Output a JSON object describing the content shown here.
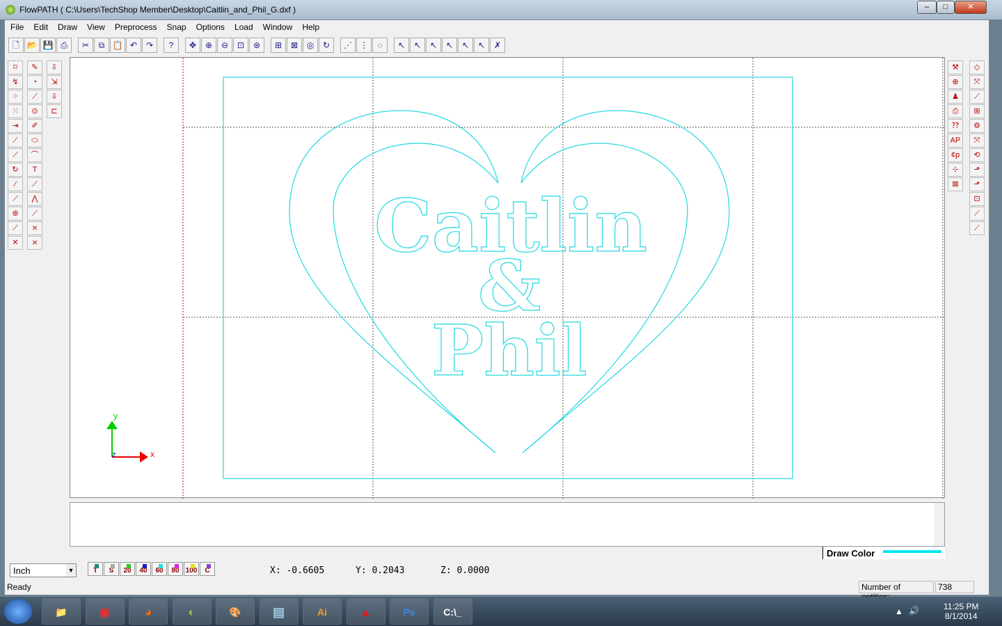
{
  "window": {
    "title": "FlowPATH ( C:\\Users\\TechShop Member\\Desktop\\Caitlin_and_Phil_G.dxf )",
    "minimize": "–",
    "maximize": "□",
    "close": "✕"
  },
  "menu": [
    "File",
    "Edit",
    "Draw",
    "View",
    "Preprocess",
    "Snap",
    "Options",
    "Load",
    "Window",
    "Help"
  ],
  "toolbar": [
    {
      "icon": "new-file-icon",
      "g": "🗋"
    },
    {
      "icon": "open-icon",
      "g": "📂"
    },
    {
      "icon": "save-icon",
      "g": "💾"
    },
    {
      "icon": "print-icon",
      "g": "⎙"
    },
    null,
    {
      "icon": "cut-icon",
      "g": "✂"
    },
    {
      "icon": "copy-icon",
      "g": "⧉"
    },
    {
      "icon": "paste-icon",
      "g": "📋"
    },
    {
      "icon": "undo-icon",
      "g": "↶"
    },
    {
      "icon": "redo-icon",
      "g": "↷"
    },
    null,
    {
      "icon": "help-icon",
      "g": "?"
    },
    null,
    {
      "icon": "pan-icon",
      "g": "✥"
    },
    {
      "icon": "zoom-in-icon",
      "g": "⊕"
    },
    {
      "icon": "zoom-out-icon",
      "g": "⊖"
    },
    {
      "icon": "zoom-window-icon",
      "g": "⊡"
    },
    {
      "icon": "zoom-extents-icon",
      "g": "⊛"
    },
    null,
    {
      "icon": "zoom-fit-icon",
      "g": "⊞"
    },
    {
      "icon": "zoom-all-icon",
      "g": "⊠"
    },
    {
      "icon": "zoom-previous-icon",
      "g": "◎"
    },
    {
      "icon": "redraw-icon",
      "g": "↻"
    },
    null,
    {
      "icon": "snap-points-icon",
      "g": "⋰"
    },
    {
      "icon": "grid-icon",
      "g": "⋮"
    },
    {
      "icon": "snap-arc-icon",
      "g": "◌"
    },
    null,
    {
      "icon": "select-icon",
      "g": "↖"
    },
    {
      "icon": "select-layer-icon",
      "g": "↖"
    },
    {
      "icon": "select-window-icon",
      "g": "↖"
    },
    {
      "icon": "select-chain-icon",
      "g": "↖"
    },
    {
      "icon": "select-line-icon",
      "g": "↖"
    },
    {
      "icon": "select-all-icon",
      "g": "↖"
    },
    {
      "icon": "deselect-icon",
      "g": "✗"
    }
  ],
  "left_tools": [
    [
      "⌑",
      "↯",
      "⁘",
      "⁙",
      "⇥",
      "⟋",
      "⟋",
      "↻",
      "⁄",
      "⟋",
      "⊛",
      "⟋",
      "✕"
    ],
    [
      "✎",
      "◔",
      "⟋",
      "⊙",
      "✐",
      "⬭",
      "⌒",
      "T",
      "⟋",
      "⋀",
      "⟋",
      "⨯",
      "⨯"
    ],
    [
      "⇩",
      "⇲",
      "⇩",
      "⊏"
    ]
  ],
  "right_tools": [
    [
      "⚒",
      "⊕",
      "♟",
      "⎙",
      "⁇",
      "AP",
      "¢p",
      "⊹",
      "⊠"
    ],
    [
      "◇",
      "⤧",
      "⟋",
      "⊞",
      "⚙",
      "⤧",
      "⟲",
      "⬏",
      "⬏",
      "⊡",
      "⟋",
      "⟋"
    ]
  ],
  "drawing": {
    "line1": "Caitlin",
    "line2": "&",
    "line3": "Phil",
    "axis_x": "x",
    "axis_y": "y",
    "axis_z": "z",
    "color": "#22d8e0"
  },
  "draw_color": {
    "label": "Draw Color",
    "color": "#00e5ee"
  },
  "units": "Inch",
  "pens": [
    {
      "label": "T",
      "color": "#1a8a7a"
    },
    {
      "label": "S",
      "color": "#aaaaaa"
    },
    {
      "label": "20",
      "color": "#22cc22"
    },
    {
      "label": "40",
      "color": "#1a1acc"
    },
    {
      "label": "60",
      "color": "#22e0e0"
    },
    {
      "label": "80",
      "color": "#e022e0"
    },
    {
      "label": "100",
      "color": "#e0e022"
    },
    {
      "label": "C",
      "color": "#8844cc"
    }
  ],
  "coords": {
    "x": "X:  -0.6605",
    "y": "Y:  0.2043",
    "z": "Z:  0.0000"
  },
  "status": "Ready",
  "entities": {
    "label": "Number of entities:",
    "value": "738"
  },
  "taskbar": [
    {
      "icon": "explorer-icon",
      "g": "📁",
      "c": "#d9b25a"
    },
    {
      "icon": "chrome-icon",
      "g": "◉",
      "c": "#d33"
    },
    {
      "icon": "firefox-icon",
      "g": "◕",
      "c": "#e76a1a"
    },
    {
      "icon": "flowpath-icon",
      "g": "◐",
      "c": "#8bc34a"
    },
    {
      "icon": "paint-icon",
      "g": "🎨",
      "c": "#ccc"
    },
    {
      "icon": "notepad-icon",
      "g": "▤",
      "c": "#9cd"
    },
    {
      "icon": "illustrator-icon",
      "g": "Ai",
      "c": "#f0a020"
    },
    {
      "icon": "autocad-icon",
      "g": "▲",
      "c": "#d02020"
    },
    {
      "icon": "photoshop-icon",
      "g": "Ps",
      "c": "#3a8ae0"
    },
    {
      "icon": "cmd-icon",
      "g": "C:\\_",
      "c": "#fff"
    }
  ],
  "clock": {
    "time": "11:25 PM",
    "date": "8/1/2014"
  }
}
